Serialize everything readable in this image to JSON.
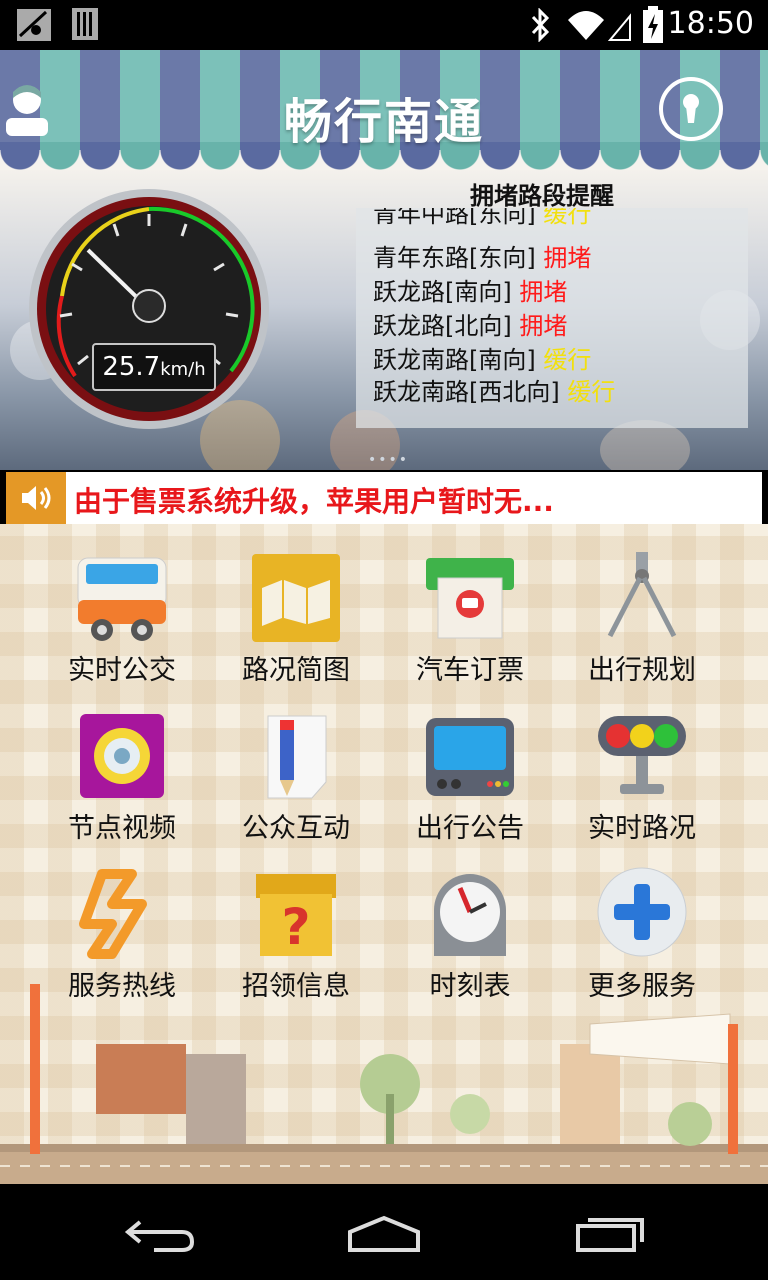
{
  "status_bar": {
    "time": "18:50"
  },
  "header": {
    "title": "畅行南通",
    "user_icon": "user-icon",
    "lock_icon": "keyhole-icon"
  },
  "speed": {
    "value": "25.7",
    "unit": "km/h"
  },
  "congestion": {
    "title": "拥堵路段提醒",
    "items": [
      {
        "road": "青年中路[东向]",
        "status": "缓行",
        "color": "#f2e00e"
      },
      {
        "road": "青年东路[东向]",
        "status": "拥堵",
        "color": "#ff1b1b"
      },
      {
        "road": "跃龙路[南向]",
        "status": "拥堵",
        "color": "#ff1b1b"
      },
      {
        "road": "跃龙路[北向]",
        "status": "拥堵",
        "color": "#ff1b1b"
      },
      {
        "road": "跃龙南路[南向]",
        "status": "缓行",
        "color": "#f2e00e"
      },
      {
        "road": "跃龙南路[西北向]",
        "status": "缓行",
        "color": "#f2e00e"
      }
    ]
  },
  "pager_dots": "••••",
  "notice": {
    "text": "由于售票系统升级，苹果用户暂时无...",
    "icon": "speaker-icon"
  },
  "menu": [
    {
      "label": "实时公交",
      "icon": "bus-icon"
    },
    {
      "label": "路况简图",
      "icon": "map-icon"
    },
    {
      "label": "汽车订票",
      "icon": "ticket-icon"
    },
    {
      "label": "出行规划",
      "icon": "compass-icon"
    },
    {
      "label": "节点视频",
      "icon": "camera-icon"
    },
    {
      "label": "公众互动",
      "icon": "pencil-paper-icon"
    },
    {
      "label": "出行公告",
      "icon": "monitor-icon"
    },
    {
      "label": "实时路况",
      "icon": "traffic-light-icon"
    },
    {
      "label": "服务热线",
      "icon": "hotline-icon"
    },
    {
      "label": "招领信息",
      "icon": "question-box-icon"
    },
    {
      "label": "时刻表",
      "icon": "clock-icon"
    },
    {
      "label": "更多服务",
      "icon": "plus-icon"
    }
  ],
  "colors": {
    "accent_red": "#ff1b1b",
    "accent_yellow": "#f2e00e",
    "notice_orange": "#e49826"
  }
}
